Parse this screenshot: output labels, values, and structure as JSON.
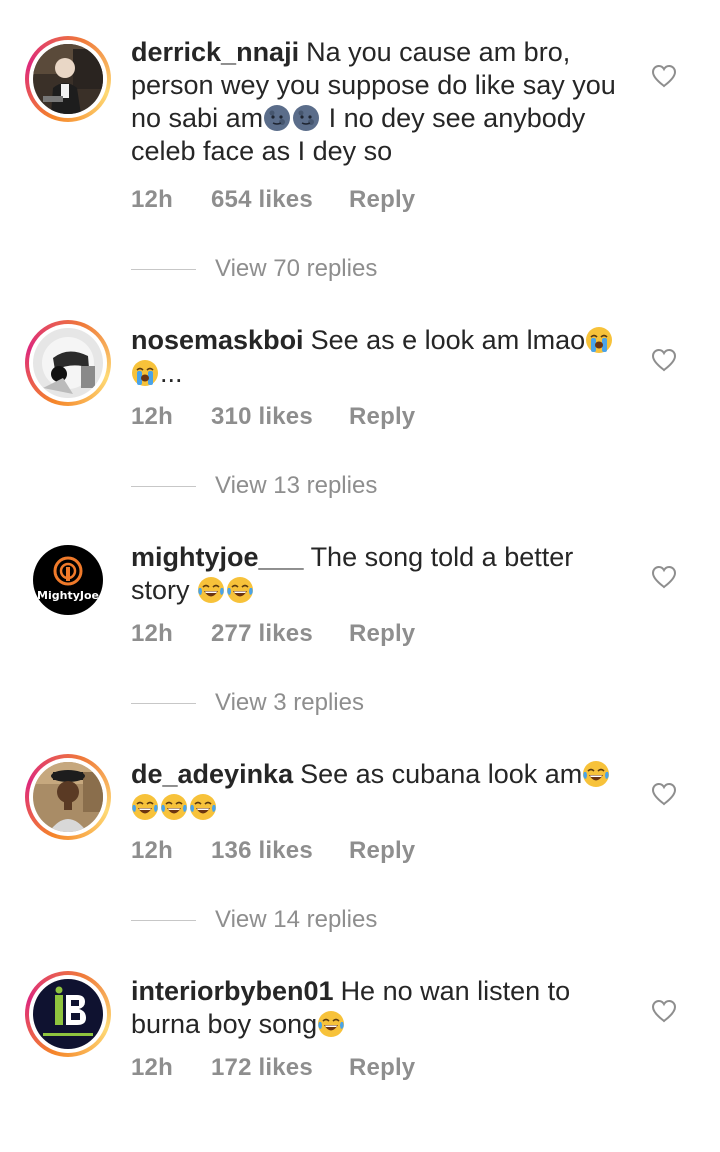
{
  "comments": [
    {
      "username": "derrick_nnaji",
      "text": "Na you cause am bro, person wey you suppose do like say you no sabi am",
      "text_after_emoji": " I no dey see anybody celeb face as I dey so",
      "emojis": [
        "new-moon-face",
        "new-moon-face"
      ],
      "time": "12h",
      "likes": "654 likes",
      "reply": "Reply",
      "view_replies": "View 70 replies",
      "avatar_ring": "story-gradient"
    },
    {
      "username": "nosemaskboi",
      "text": "See as e look am lmao",
      "text_after_emoji": "...",
      "emojis": [
        "loudly-crying-face",
        "loudly-crying-face"
      ],
      "time": "12h",
      "likes": "310 likes",
      "reply": "Reply",
      "view_replies": "View 13 replies",
      "avatar_ring": "story-gradient"
    },
    {
      "username": "mightyjoe___",
      "text": "The song told a better story",
      "text_after_emoji": "",
      "emojis": [
        "tears-of-joy-face",
        "tears-of-joy-face"
      ],
      "time": "12h",
      "likes": "277 likes",
      "reply": "Reply",
      "view_replies": "View 3 replies",
      "avatar_ring": "none",
      "avatar_logo_text": "MightyJoe"
    },
    {
      "username": "de_adeyinka",
      "text": "See as cubana look am",
      "text_after_emoji": "",
      "emojis": [
        "tears-of-joy-face",
        "tears-of-joy-face",
        "tears-of-joy-face",
        "tears-of-joy-face"
      ],
      "time": "12h",
      "likes": "136 likes",
      "reply": "Reply",
      "view_replies": "View 14 replies",
      "avatar_ring": "story-gradient"
    },
    {
      "username": "interiorbyben01",
      "text": "He no wan listen to burna boy song",
      "text_after_emoji": "",
      "emojis": [
        "tears-of-joy-face"
      ],
      "time": "12h",
      "likes": "172 likes",
      "reply": "Reply",
      "view_replies": "",
      "avatar_ring": "story-gradient"
    }
  ],
  "icons": {
    "like": "heart-outline-icon"
  },
  "colors": {
    "text": "#262626",
    "secondary": "#8e8e8e",
    "ring_start": "#f58529",
    "ring_end": "#dd2a7b"
  }
}
